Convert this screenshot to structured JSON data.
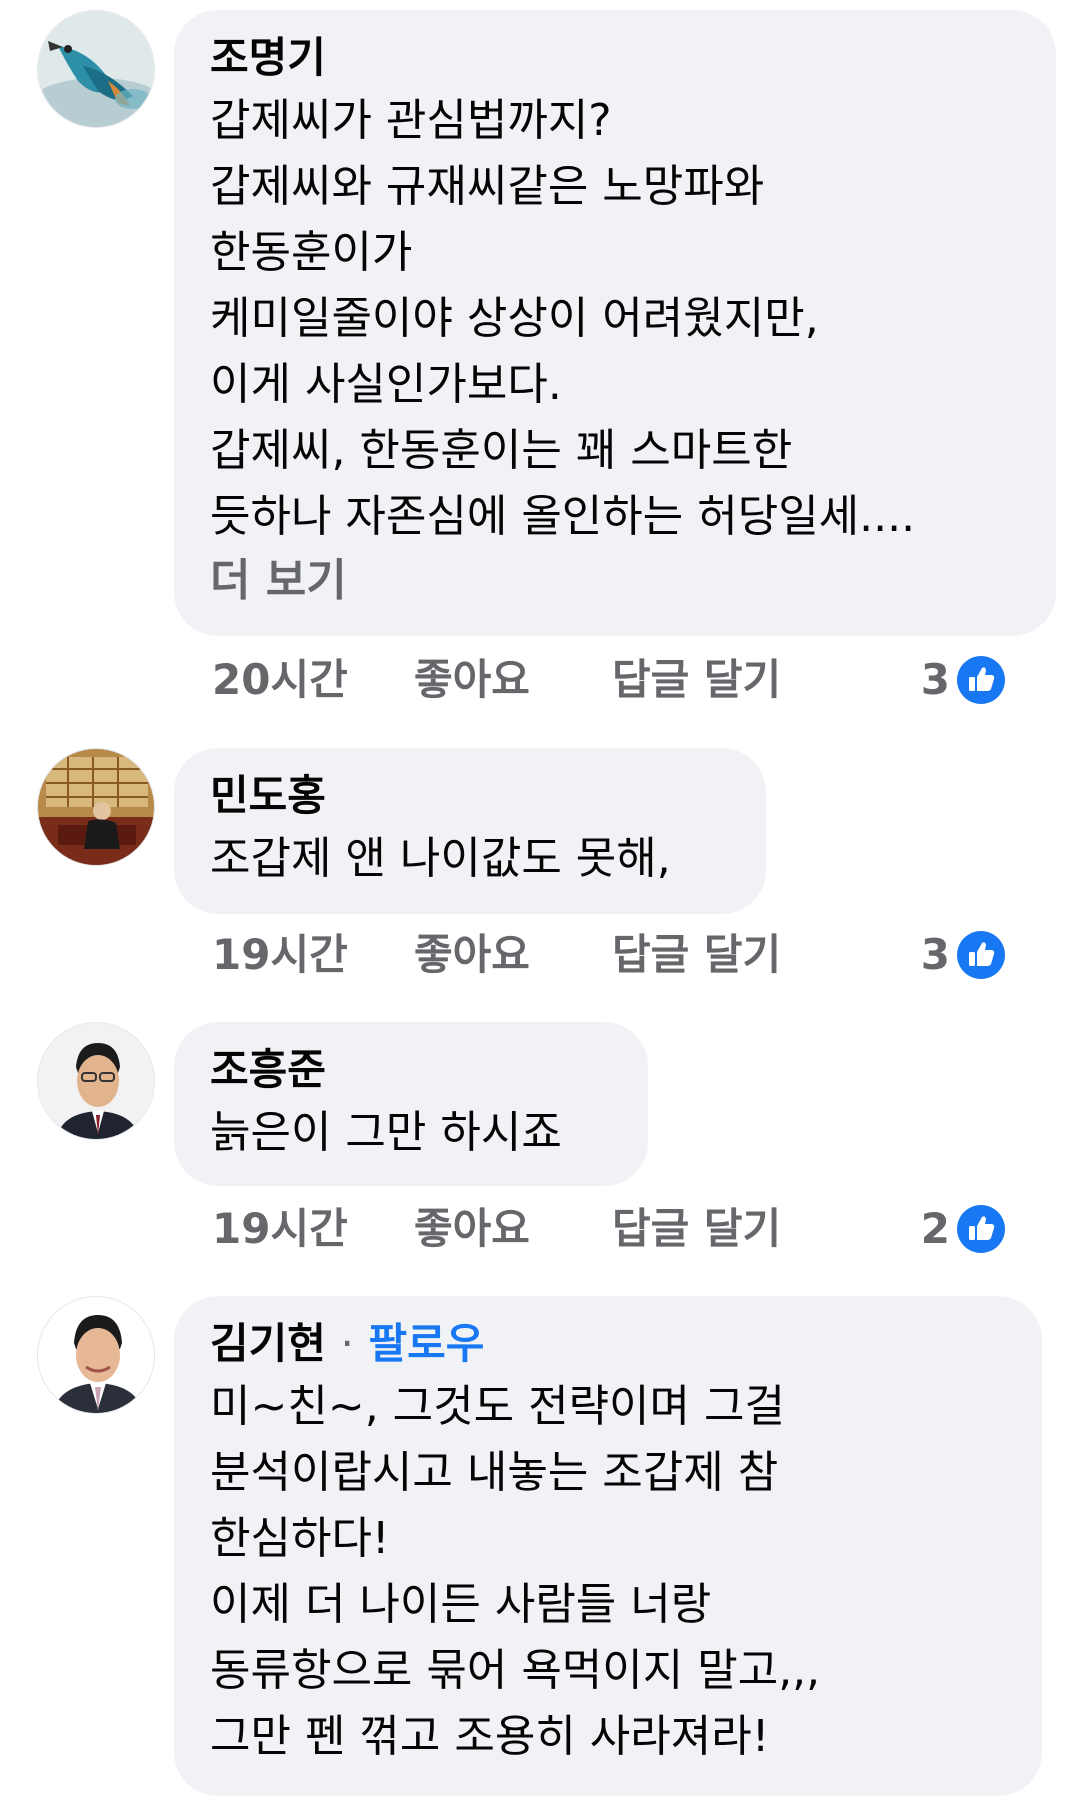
{
  "comments": [
    {
      "author": "조명기",
      "lines": [
        "갑제씨가 관심법까지?",
        "갑제씨와 규재씨같은 노망파와",
        "한동훈이가",
        "케미일줄이야 상상이 어려웠지만,",
        "이게 사실인가보다.",
        "갑제씨, 한동훈이는 꽤 스마트한",
        "듯하나 자존심에 올인하는 허당일세...."
      ],
      "see_more": "더 보기",
      "time": "20시간",
      "like": "좋아요",
      "reply": "답글 달기",
      "reaction_count": "3",
      "avatar_icon": "kingfisher-bird-avatar"
    },
    {
      "author": "민도홍",
      "lines": [
        "조갑제 앤 나이값도 못해,"
      ],
      "time": "19시간",
      "like": "좋아요",
      "reply": "답글 달기",
      "reaction_count": "3",
      "avatar_icon": "person-in-room-avatar"
    },
    {
      "author": "조흥준",
      "lines": [
        "늙은이 그만 하시죠"
      ],
      "time": "19시간",
      "like": "좋아요",
      "reply": "답글 달기",
      "reaction_count": "2",
      "avatar_icon": "man-portrait-avatar"
    },
    {
      "author": "김기현",
      "follow_sep": "·",
      "follow": "팔로우",
      "lines": [
        "미~친~, 그것도 전략이며 그걸",
        "분석이랍시고 내놓는 조갑제 참",
        "한심하다!",
        "이제 더 나이든 사람들 너랑",
        "동류항으로 묶어 욕먹이지 말고,,,",
        "그만 펜 꺾고 조용히 사라져라!"
      ],
      "avatar_icon": "man-suit-portrait-avatar"
    }
  ],
  "colors": {
    "bubble": "#f0f2f5",
    "secondary_text": "#65676b",
    "link_blue": "#1877f2"
  }
}
